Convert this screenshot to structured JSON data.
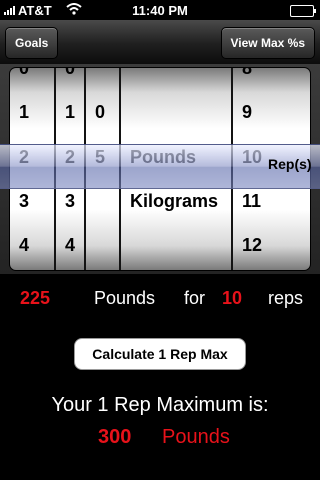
{
  "status_bar": {
    "carrier": "AT&T",
    "time": "11:40 PM"
  },
  "nav": {
    "left_button": "Goals",
    "right_button": "View Max %s"
  },
  "picker": {
    "wheel1": [
      "0",
      "1",
      "2",
      "3",
      "4"
    ],
    "wheel2": [
      "0",
      "1",
      "2",
      "3",
      "4"
    ],
    "wheel3": [
      "",
      "0",
      "5",
      "",
      ""
    ],
    "wheel4": [
      "",
      "",
      "Pounds",
      "Kilograms",
      ""
    ],
    "wheel5": [
      "8",
      "9",
      "10",
      "11",
      "12"
    ],
    "selection_label": "Rep(s)"
  },
  "summary": {
    "weight": "225",
    "unit": "Pounds",
    "for_word": "for",
    "reps": "10",
    "reps_word": "reps"
  },
  "calculate_button": "Calculate 1 Rep Max",
  "result": {
    "label": "Your 1 Rep Maximum is:",
    "value": "300",
    "unit": "Pounds"
  },
  "colors": {
    "accent_red": "#e8121a",
    "background": "#000000"
  }
}
